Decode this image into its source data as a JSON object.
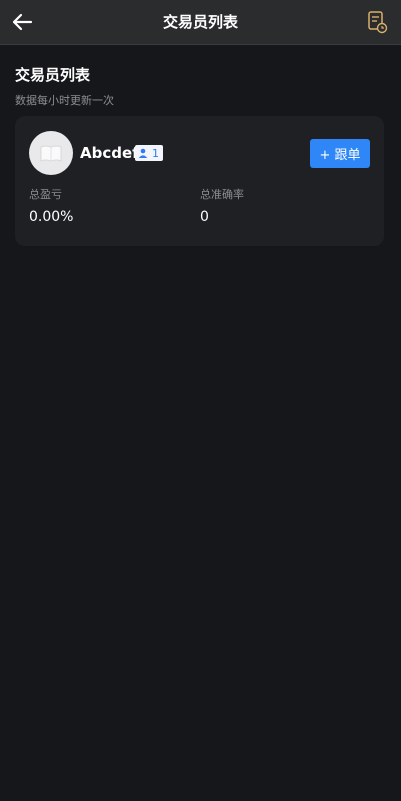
{
  "header": {
    "title": "交易员列表",
    "back_icon": "arrow-left-icon",
    "record_icon": "document-clock-icon",
    "accent_color": "#d9b06c"
  },
  "section": {
    "title": "交易员列表",
    "subtitle": "数据每小时更新一次"
  },
  "traders": [
    {
      "name": "Abcdef",
      "avatar_icon": "image-placeholder-icon",
      "followers": "1",
      "follow_label": "+ 跟单",
      "stats": {
        "pnl_label": "总盈亏",
        "pnl_value": "0.00%",
        "accuracy_label": "总准确率",
        "accuracy_value": "0"
      }
    }
  ],
  "colors": {
    "background": "#15171b",
    "card": "#1f2024",
    "button": "#2f86f6",
    "badge_text": "#2f7bf6"
  }
}
